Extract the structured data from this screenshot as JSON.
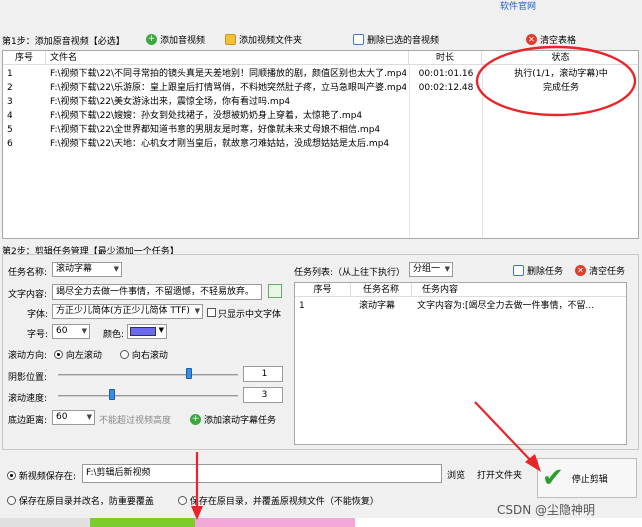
{
  "top_link": "软件官网",
  "step1": {
    "title": "第1步：添加原音视频【必选】",
    "buttons": {
      "add_av": "添加音视频",
      "add_folder": "添加视频文件夹",
      "delete_selected": "删除已选的音视频",
      "clear_table": "清空表格"
    },
    "columns": [
      "序号",
      "文件名",
      "时长",
      "状态"
    ],
    "rows": [
      {
        "no": "1",
        "file": "F:\\视频下载\\22\\不同寻常拍的镜头真是天差地别！同顺播放的剧，颜值区别也太大了.mp4",
        "duration": "00:01:01.16",
        "status": "执行(1/1，滚动字幕)中"
      },
      {
        "no": "2",
        "file": "F:\\视频下载\\22\\乐游原：皇上跟皇后打情骂俏，不料她突然肚子疼，立马急眼叫产婆.mp4",
        "duration": "00:02:12.48",
        "status": "完成任务"
      },
      {
        "no": "3",
        "file": "F:\\视频下载\\22\\美女游泳出来，震惊全场，你有看过吗.mp4",
        "duration": "",
        "status": ""
      },
      {
        "no": "4",
        "file": "F:\\视频下载\\22\\嫂嫂：孙女到处找裙子，没想被奶奶身上穿着，太惊艳了.mp4",
        "duration": "",
        "status": ""
      },
      {
        "no": "5",
        "file": "F:\\视频下载\\22\\全世界都知道书意的男朋友是时寒，好像就未来丈母娘不相信.mp4",
        "duration": "",
        "status": ""
      },
      {
        "no": "6",
        "file": "F:\\视频下载\\22\\天地：心机女才刚当皇后，就故意刁难姑姑，没成想姑姑是太后.mp4",
        "duration": "",
        "status": ""
      }
    ]
  },
  "step2": {
    "title": "第2步：剪辑任务管理【最少添加一个任务】",
    "task_name_label": "任务名称:",
    "task_name_value": "滚动字幕",
    "text_label": "文字内容:",
    "text_value": "竭尽全力去做一件事情，不留遗憾，不轻易放弃。",
    "font_label": "字体:",
    "font_value": "方正少儿简体(方正少儿简体 TTF)",
    "chinese_only": "只显示中文字体",
    "size_label": "字号:",
    "size_value": "60",
    "color_label": "颜色:",
    "direction_label": "滚动方向:",
    "dir_left": "向左滚动",
    "dir_right": "向右滚动",
    "shadow_label": "阴影位置:",
    "shadow_value": "1",
    "shadow_level": 0.73,
    "speed_label": "滚动速度:",
    "speed_value": "3",
    "speed_level": 0.3,
    "bottom_label": "底边距离:",
    "bottom_value": "60",
    "bottom_hint": "不能超过视频高度",
    "add_task_button": "添加滚动字幕任务",
    "task_list_label": "任务列表:（从上往下执行）",
    "group_value": "分组一",
    "delete_task": "删除任务",
    "clear_tasks": "清空任务",
    "task_columns": [
      "序号",
      "任务名称",
      "任务内容"
    ],
    "tasks": [
      {
        "no": "1",
        "name": "滚动字幕",
        "content": "文字内容为:[竭尽全力去做一件事情，不留..."
      }
    ]
  },
  "output": {
    "save_new_label": "新视频保存在:",
    "save_path": "F:\\剪辑后新视频",
    "browse": "浏览",
    "open_folder": "打开文件夹",
    "save_rename": "保存在原目录并改名，防重要覆盖",
    "save_overwrite": "保存在原目录，并覆盖原视频文件（不能恢复）",
    "stop_button": "停止剪辑"
  },
  "watermark": "CSDN @尘隐神明",
  "colors": {
    "annotation_red": "#e8262a",
    "progress_green": "#7ccc2e",
    "progress_pink": "#f2a7d8",
    "swatch_blue": "#6b6bf0"
  }
}
